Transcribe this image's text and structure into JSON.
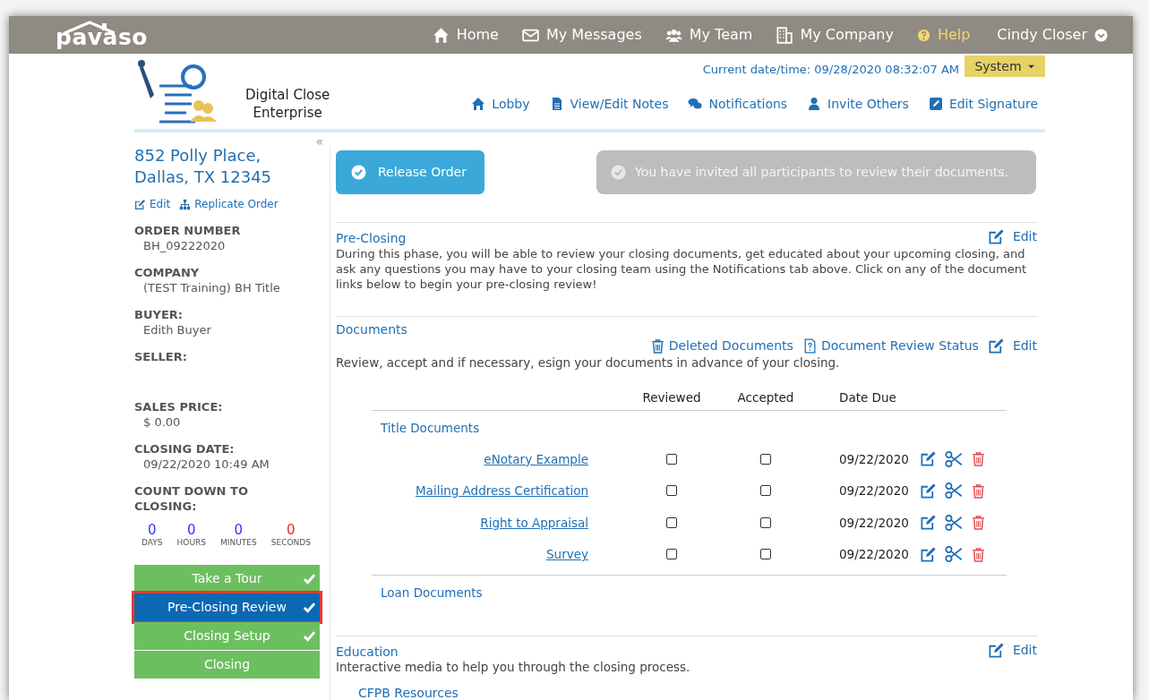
{
  "top_nav": {
    "brand": "pavaso",
    "items": [
      {
        "label": "Home"
      },
      {
        "label": "My Messages"
      },
      {
        "label": "My Team"
      },
      {
        "label": "My Company"
      },
      {
        "label": "Help",
        "kind": "help"
      }
    ],
    "user": "Cindy Closer"
  },
  "header": {
    "product_line1": "Digital Close",
    "product_line2": "Enterprise",
    "datetime": "Current date/time: 09/28/2020 08:32:07 AM",
    "system_button": "System",
    "links": [
      {
        "label": "Lobby"
      },
      {
        "label": "View/Edit Notes"
      },
      {
        "label": "Notifications"
      },
      {
        "label": "Invite Others"
      },
      {
        "label": "Edit Signature"
      }
    ]
  },
  "sidebar": {
    "collapse": "«",
    "address": "852 Polly Place, Dallas, TX 12345",
    "actions": [
      {
        "label": "Edit"
      },
      {
        "label": "Replicate Order"
      }
    ],
    "fields": [
      {
        "label": "ORDER NUMBER",
        "value": "BH_09222020"
      },
      {
        "label": "COMPANY",
        "value": "(TEST Training) BH Title"
      },
      {
        "label": "BUYER:",
        "value": "Edith Buyer"
      },
      {
        "label": "SELLER:"
      },
      {
        "label": "SALES PRICE:",
        "value": "$ 0.00"
      },
      {
        "label": "CLOSING DATE:",
        "value": "09/22/2020 10:49 AM"
      }
    ],
    "countdown_title": "COUNT DOWN TO CLOSING:",
    "countdown": [
      {
        "value": "0",
        "unit": "DAYS",
        "color": "#3333ff"
      },
      {
        "value": "0",
        "unit": "HOURS",
        "color": "#3333ff"
      },
      {
        "value": "0",
        "unit": "MINUTES",
        "color": "#3333ff"
      },
      {
        "value": "0",
        "unit": "SECONDS",
        "color": "#ff2222"
      }
    ],
    "steps": [
      {
        "label": "Take a Tour",
        "done": true,
        "selected": false
      },
      {
        "label": "Pre-Closing Review",
        "done": true,
        "selected": true
      },
      {
        "label": "Closing Setup",
        "done": true,
        "selected": false
      },
      {
        "label": "Closing",
        "done": false,
        "selected": false
      }
    ]
  },
  "main": {
    "release_button": "Release Order",
    "notice": "You have invited all participants to review their documents.",
    "pre_closing": {
      "title": "Pre-Closing",
      "edit": "Edit",
      "text": "During this phase, you will be able to review your closing documents, get educated about your upcoming closing, and ask any questions you may have to your closing team using the Notifications tab above. Click on any of the document links below to begin your pre-closing review!"
    },
    "documents": {
      "title": "Documents",
      "deleted": "Deleted Documents",
      "review_status": "Document Review Status",
      "edit": "Edit",
      "text": "Review, accept and if necessary, esign your documents in advance of your closing.",
      "columns": [
        "Reviewed",
        "Accepted",
        "Date Due"
      ],
      "groups": [
        {
          "title": "Title Documents",
          "rows": [
            {
              "name": "eNotary Example",
              "reviewed": false,
              "accepted": false,
              "due": "09/22/2020"
            },
            {
              "name": "Mailing Address Certification",
              "reviewed": false,
              "accepted": false,
              "due": "09/22/2020"
            },
            {
              "name": "Right to Appraisal",
              "reviewed": false,
              "accepted": false,
              "due": "09/22/2020"
            },
            {
              "name": "Survey",
              "reviewed": false,
              "accepted": false,
              "due": "09/22/2020"
            }
          ]
        },
        {
          "title": "Loan Documents"
        }
      ]
    },
    "education": {
      "title": "Education",
      "edit": "Edit",
      "text": "Interactive media to help you through the closing process.",
      "link": "CFPB Resources"
    }
  }
}
